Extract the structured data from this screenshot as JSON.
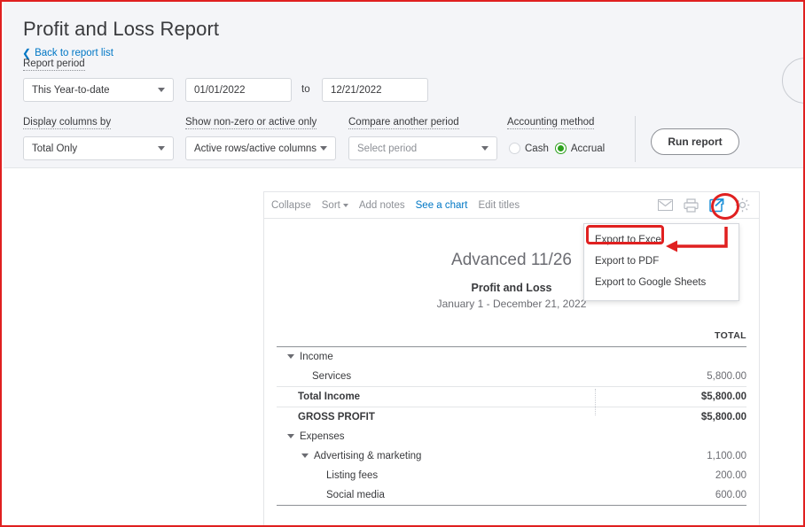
{
  "page": {
    "title": "Profit and Loss Report",
    "back_link": "Back to report list",
    "back_chevron": "chevron-left-icon"
  },
  "filters": {
    "report_period": {
      "label": "Report period",
      "select_value": "This Year-to-date",
      "from_value": "01/01/2022",
      "to_word": "to",
      "to_value": "12/21/2022"
    },
    "display_columns": {
      "label": "Display columns by",
      "value": "Total Only"
    },
    "show_nonzero": {
      "label": "Show non-zero or active only",
      "value": "Active rows/active columns"
    },
    "compare_period": {
      "label": "Compare another period",
      "placeholder": "Select period",
      "value": "Select period"
    },
    "accounting_method": {
      "label": "Accounting method",
      "options": [
        "Cash",
        "Accrual"
      ],
      "selected": "Accrual",
      "selected_color": "#2ca01c"
    },
    "run_report_label": "Run report"
  },
  "report": {
    "toolbar": {
      "links": [
        {
          "label": "Collapse",
          "accent": false
        },
        {
          "label": "Sort",
          "accent": false,
          "caret": true
        },
        {
          "label": "Add notes",
          "accent": false
        },
        {
          "label": "See a chart",
          "accent": true
        },
        {
          "label": "Edit titles",
          "accent": false
        }
      ],
      "icons": [
        {
          "name": "email-icon"
        },
        {
          "name": "print-icon"
        },
        {
          "name": "export-icon"
        },
        {
          "name": "gear-icon"
        }
      ]
    },
    "company_name": "Advanced 11/26",
    "report_name": "Profit and Loss",
    "date_range": "January 1 - December 21, 2022",
    "column_header": "TOTAL",
    "rows": [
      {
        "label": "Income",
        "amount": "",
        "indent": 0,
        "toggle": true,
        "bold": false,
        "style": "plain"
      },
      {
        "label": "Services",
        "amount": "5,800.00",
        "indent": 1,
        "toggle": false,
        "bold": false,
        "style": "plain"
      },
      {
        "label": "Total Income",
        "amount": "$5,800.00",
        "indent": 0,
        "toggle": false,
        "bold": true,
        "style": "ruled"
      },
      {
        "label": "GROSS PROFIT",
        "amount": "$5,800.00",
        "indent": 0,
        "toggle": false,
        "bold": true,
        "style": "ruled"
      },
      {
        "label": "Expenses",
        "amount": "",
        "indent": 0,
        "toggle": true,
        "bold": false,
        "style": "plain"
      },
      {
        "label": "Advertising & marketing",
        "amount": "1,100.00",
        "indent": 1,
        "toggle": true,
        "bold": false,
        "style": "plain"
      },
      {
        "label": "Listing fees",
        "amount": "200.00",
        "indent": 2,
        "toggle": false,
        "bold": false,
        "style": "plain"
      },
      {
        "label": "Social media",
        "amount": "600.00",
        "indent": 2,
        "toggle": false,
        "bold": false,
        "style": "ruled-bottom"
      }
    ]
  },
  "export_menu": {
    "items": [
      "Export to Excel",
      "Export to PDF",
      "Export to Google Sheets"
    ],
    "highlighted": "Export to Excel"
  },
  "annotations": {
    "color": "#e02020",
    "circle_target": "export-icon",
    "rect_target": "Export to Excel",
    "arrow": "arrow-pointing-left"
  }
}
